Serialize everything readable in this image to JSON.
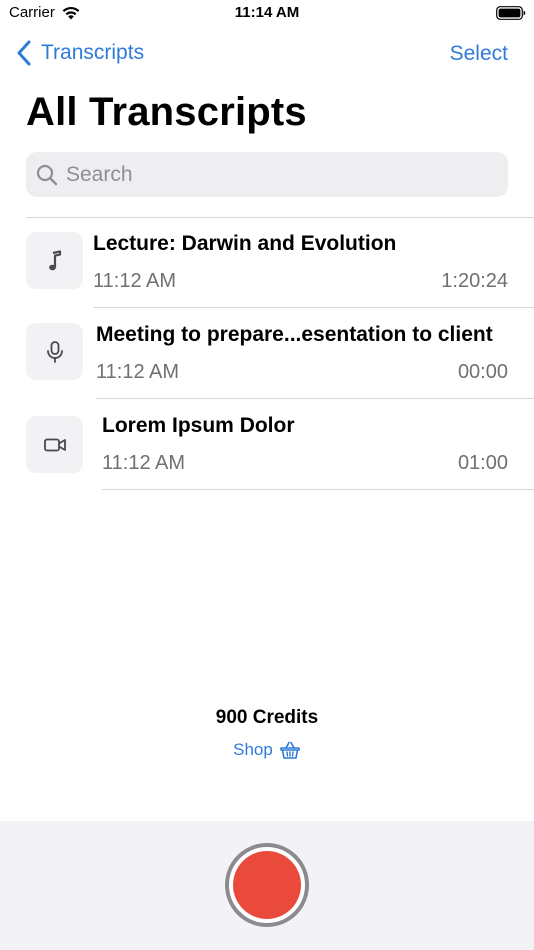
{
  "status_bar": {
    "carrier": "Carrier",
    "time": "11:14 AM"
  },
  "nav": {
    "back_label": "Transcripts",
    "select_label": "Select"
  },
  "page_title": "All Transcripts",
  "search": {
    "placeholder": "Search",
    "value": ""
  },
  "transcripts": [
    {
      "title": "Lecture: Darwin and Evolution",
      "time": "11:12 AM",
      "duration": "1:20:24",
      "icon": "music-note-icon"
    },
    {
      "title": "Meeting to prepare...esentation to client",
      "time": "11:12 AM",
      "duration": "00:00",
      "icon": "microphone-icon"
    },
    {
      "title": "Lorem Ipsum Dolor",
      "time": "11:12 AM",
      "duration": "01:00",
      "icon": "video-camera-icon"
    }
  ],
  "credits": {
    "label": "900 Credits",
    "shop_label": "Shop"
  },
  "colors": {
    "accent": "#2f7bd9",
    "record": "#ea4a3c",
    "secondary_text": "#707074"
  }
}
